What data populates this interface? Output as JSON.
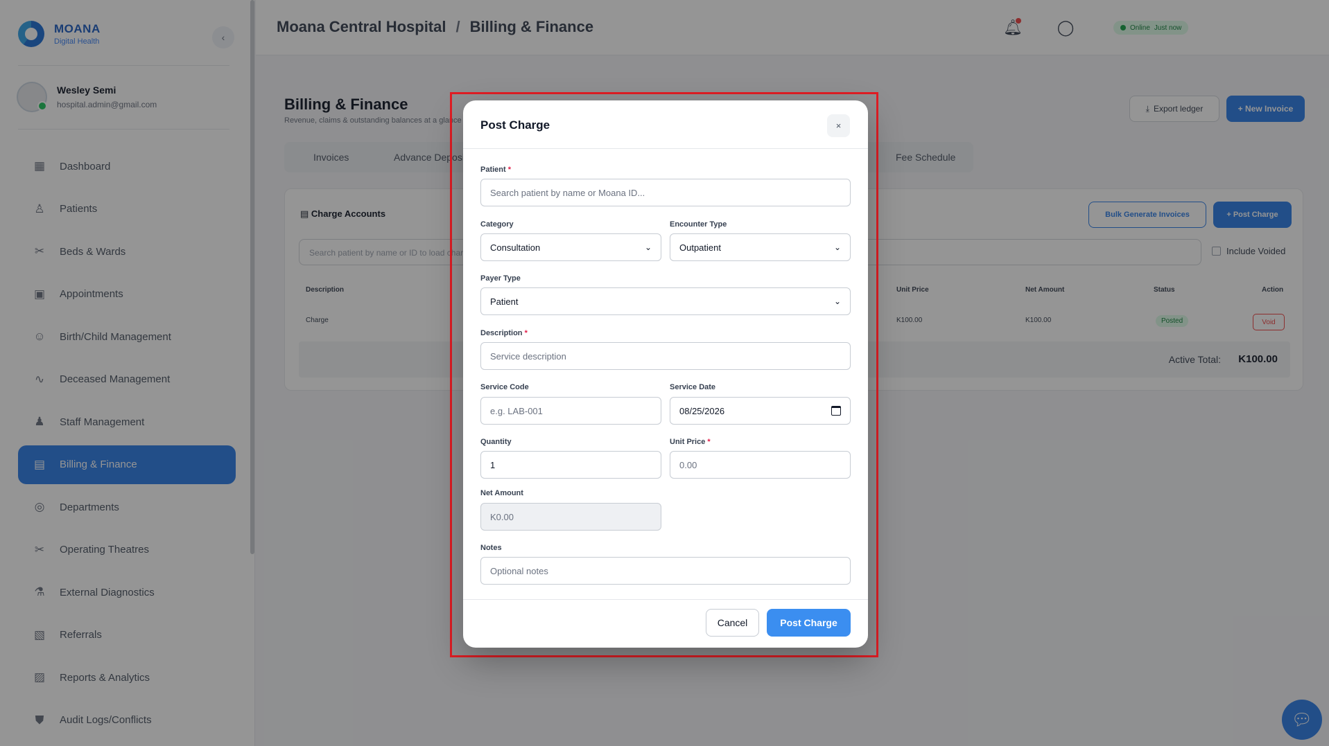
{
  "brand": {
    "name": "MOANA",
    "subtitle": "Digital Health"
  },
  "user": {
    "name": "Wesley Semi",
    "email": "hospital.admin@gmail.com"
  },
  "sidebar": {
    "items": [
      {
        "label": "Dashboard",
        "icon": "grid-icon"
      },
      {
        "label": "Patients",
        "icon": "person-icon"
      },
      {
        "label": "Beds & Wards",
        "icon": "bed-icon"
      },
      {
        "label": "Appointments",
        "icon": "calendar-icon"
      },
      {
        "label": "Birth/Child Management",
        "icon": "baby-icon"
      },
      {
        "label": "Deceased Management",
        "icon": "pulse-icon"
      },
      {
        "label": "Staff Management",
        "icon": "staff-icon"
      },
      {
        "label": "Billing & Finance",
        "icon": "receipt-icon",
        "active": true
      },
      {
        "label": "Departments",
        "icon": "building-icon"
      },
      {
        "label": "Operating Theatres",
        "icon": "scalpel-icon"
      },
      {
        "label": "External Diagnostics",
        "icon": "microscope-icon"
      },
      {
        "label": "Referrals",
        "icon": "clipboard-icon"
      },
      {
        "label": "Reports & Analytics",
        "icon": "chart-icon"
      },
      {
        "label": "Audit Logs/Conflicts",
        "icon": "shield-icon"
      }
    ]
  },
  "header": {
    "breadcrumb": [
      "Moana Central Hospital",
      "Billing & Finance"
    ],
    "status": "Online",
    "status_detail": "Just now"
  },
  "page": {
    "title": "Billing & Finance",
    "subtitle": "Revenue, claims & outstanding balances at a glance",
    "export_label": "Export ledger",
    "new_invoice_label": "+ New Invoice",
    "tabs": [
      "Invoices",
      "Advance Deposits",
      "Fee Schedule"
    ],
    "card_title": "Charge Accounts",
    "bulk_label": "Bulk Generate Invoices",
    "post_charge_label": "+ Post Charge",
    "search_placeholder": "Search patient by name or ID to load charges...",
    "include_voided": "Include Voided",
    "table_headers": [
      "Description",
      "Unit Price",
      "Net Amount",
      "Status",
      "Action"
    ],
    "row": {
      "description": "Charge",
      "unit_price": "K100.00",
      "net_amount": "K100.00",
      "status": "Posted",
      "action": "Void"
    },
    "total_label": "Active Total:",
    "total_value": "K100.00"
  },
  "modal": {
    "title": "Post Charge",
    "close": "×",
    "patient_label": "Patient",
    "patient_placeholder": "Search patient by name or Moana ID...",
    "category_label": "Category",
    "category_value": "Consultation",
    "encounter_label": "Encounter Type",
    "encounter_value": "Outpatient",
    "payer_label": "Payer Type",
    "payer_value": "Patient",
    "description_label": "Description",
    "description_placeholder": "Service description",
    "service_code_label": "Service Code",
    "service_code_placeholder": "e.g. LAB-001",
    "service_date_label": "Service Date",
    "service_date_value": "08/25/2026",
    "quantity_label": "Quantity",
    "quantity_value": "1",
    "unit_price_label": "Unit Price",
    "unit_price_placeholder": "0.00",
    "net_amount_label": "Net Amount",
    "net_amount_value": "K0.00",
    "notes_label": "Notes",
    "notes_placeholder": "Optional notes",
    "required_mark": "*",
    "cancel_label": "Cancel",
    "submit_label": "Post Charge"
  },
  "colors": {
    "accent": "#2f7ee8",
    "highlight": "#e11d24",
    "danger": "#ef4444",
    "success": "#16a34a"
  }
}
